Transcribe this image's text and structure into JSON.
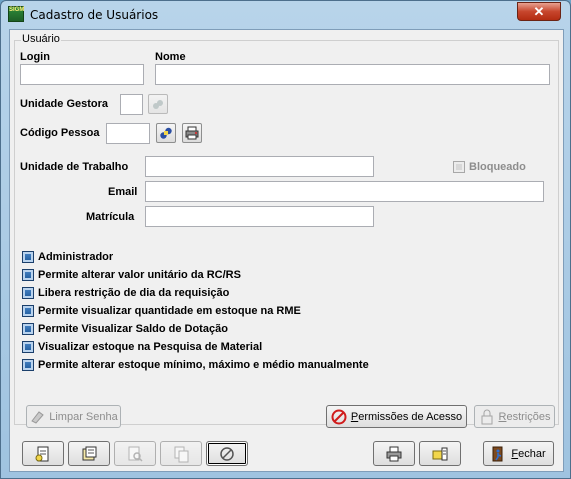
{
  "window": {
    "title": "Cadastro de Usuários",
    "app_icon_text": "SIGM",
    "close_glyph": "✕"
  },
  "group": {
    "legend": "Usuário"
  },
  "fields": {
    "login_label": "Login",
    "login_value": "",
    "nome_label": "Nome",
    "nome_value": "",
    "unidade_gestora_label": "Unidade Gestora",
    "unidade_gestora_value": "",
    "codigo_pessoa_label": "Código Pessoa",
    "codigo_pessoa_value": "",
    "unidade_trabalho_label": "Unidade de Trabalho",
    "unidade_trabalho_value": "",
    "email_label": "Email",
    "email_value": "",
    "matricula_label": "Matrícula",
    "matricula_value": ""
  },
  "bloqueado": {
    "label": "Bloqueado",
    "enabled": false
  },
  "permissions": [
    "Administrador",
    "Permite alterar valor unitário da RC/RS",
    "Libera restrição de dia da requisição",
    "Permite visualizar quantidade em estoque na RME",
    "Permite Visualizar Saldo de Dotação",
    "Visualizar estoque na Pesquisa de Material",
    "Permite alterar estoque mínimo, máximo e médio manualmente"
  ],
  "buttons": {
    "limpar_senha": "Limpar Senha",
    "permissoes_acesso_u": "P",
    "permissoes_acesso_rest": "ermissões de Acesso",
    "restricoes_u": "R",
    "restricoes_rest": "estrições",
    "fechar_u": "F",
    "fechar_rest": "echar"
  },
  "toolbar_icons": [
    "new-doc-icon",
    "edit-doc-icon",
    "search-doc-icon",
    "copy-doc-icon",
    "cancel-icon"
  ],
  "colors": {
    "titlebar": "#b8d4ea",
    "checkbox_blue": "#1e5a9c",
    "close_red": "#c7462d"
  }
}
